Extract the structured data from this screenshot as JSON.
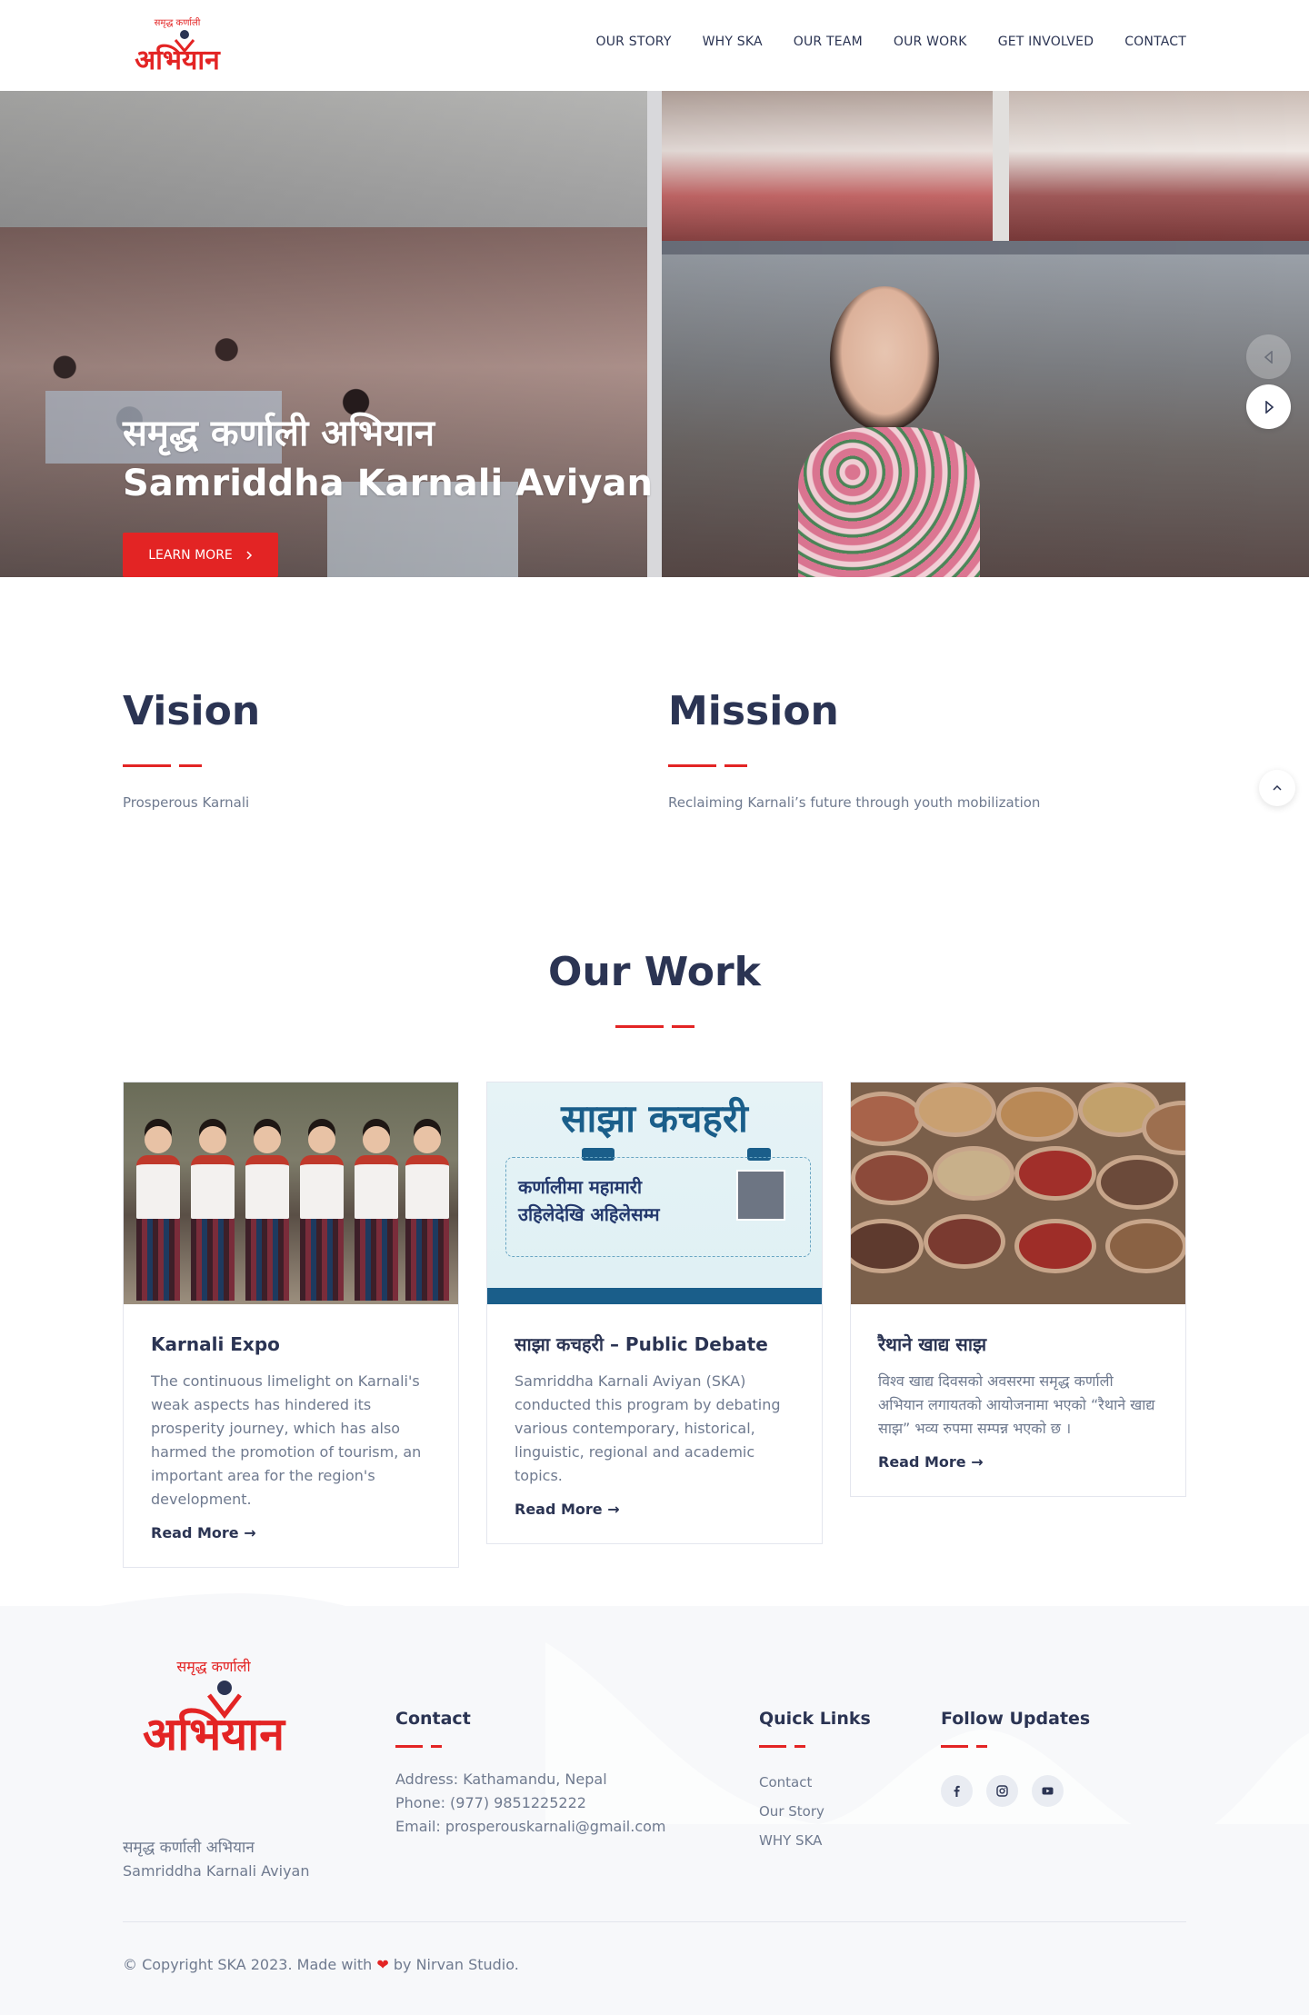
{
  "brand": {
    "logo_tagline_np": "समृद्ध कर्णाली",
    "logo_word_np": "अभियान",
    "name_np": "समृद्ध कर्णाली अभियान",
    "name_en": "Samriddha Karnali Aviyan",
    "accent_color": "#e32424",
    "navy_color": "#2b3453"
  },
  "nav": {
    "items": [
      "OUR STORY",
      "WHY SKA",
      "OUR TEAM",
      "OUR WORK",
      "GET INVOLVED",
      "CONTACT"
    ]
  },
  "hero": {
    "title_np": "समृद्ध कर्णाली अभियान",
    "title_en": "Samriddha Karnali Aviyan",
    "button_label": "LEARN MORE",
    "button_icon": "chevron-right-icon",
    "prev_icon": "triangle-left-icon",
    "next_icon": "triangle-right-icon"
  },
  "vision": {
    "heading": "Vision",
    "text": "Prosperous Karnali"
  },
  "mission": {
    "heading": "Mission",
    "text": "Reclaiming Karnali’s future through youth mobilization"
  },
  "scroll_top_icon": "chevron-up-icon",
  "work": {
    "heading": "Our Work",
    "cards": [
      {
        "title": "Karnali Expo",
        "text": "The continuous limelight on Karnali's weak aspects has hindered its prosperity journey, which has also harmed the promotion of tourism, an important area for the region's development.",
        "link": "Read More →"
      },
      {
        "title": "साझा कचहरी – Public Debate",
        "text": "Samriddha Karnali Aviyan (SKA) conducted this program by debating various contemporary, historical, linguistic, regional and academic topics.",
        "link": "Read More →",
        "poster_title": "साझा कचहरी",
        "poster_subtitle_1": "कर्णालीमा महामारी",
        "poster_subtitle_2": "उहिलेदेखि अहिलेसम्म"
      },
      {
        "title": "रैथाने खाद्य साझ",
        "text": "विश्व खाद्य दिवसको अवसरमा समृद्ध कर्णाली अभियान लगायतको आयोजनामा भएको “रैथाने खाद्य साझ” भव्य रुपमा सम्पन्न भएको छ ।",
        "link": "Read More →"
      }
    ]
  },
  "footer": {
    "brand_np": "समृद्ध कर्णाली अभियान",
    "brand_en": "Samriddha Karnali Aviyan",
    "contact": {
      "heading": "Contact",
      "address": "Address: Kathamandu, Nepal",
      "phone": "Phone: (977) 9851225222",
      "email": "Email: prosperouskarnali@gmail.com"
    },
    "quick_links": {
      "heading": "Quick Links",
      "items": [
        "Contact",
        "Our Story",
        "WHY SKA"
      ]
    },
    "follow": {
      "heading": "Follow Updates",
      "icons": [
        "facebook-icon",
        "instagram-icon",
        "youtube-icon"
      ]
    },
    "copyright_pre": "© Copyright SKA 2023. Made with",
    "copyright_post": "by Nirvan Studio."
  }
}
